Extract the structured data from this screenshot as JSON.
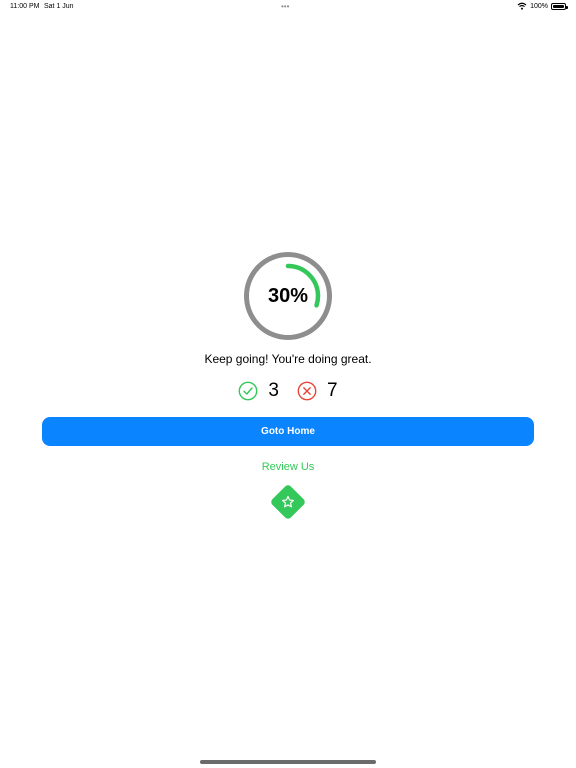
{
  "status_bar": {
    "time": "11:00 PM",
    "date": "Sat 1 Jun",
    "dots": "•••",
    "battery": "100%"
  },
  "result": {
    "progress_percent": 30,
    "progress_label": "30%",
    "message": "Keep going! You're doing great.",
    "correct_count": "3",
    "wrong_count": "7"
  },
  "actions": {
    "goto_home_label": "Goto Home",
    "review_label": "Review Us"
  },
  "colors": {
    "accent_blue": "#0a84ff",
    "success_green": "#34c759",
    "error_red": "#e5463b",
    "ring_track": "#8e8e8e"
  }
}
